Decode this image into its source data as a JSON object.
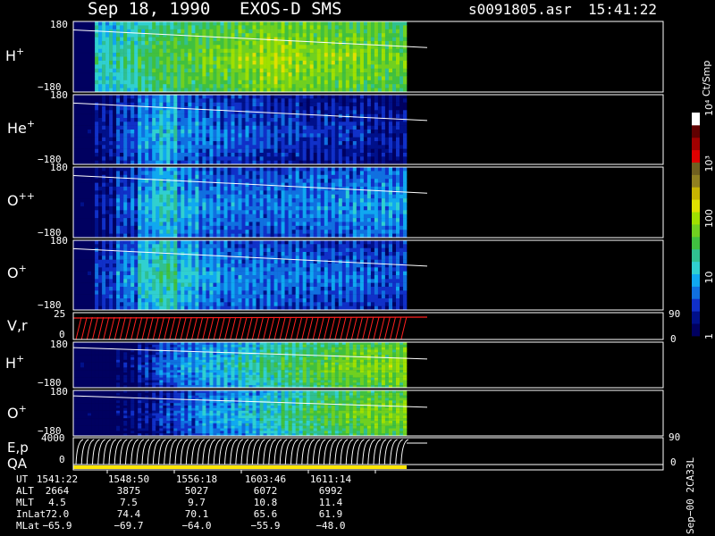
{
  "header": {
    "date": "Sep 18, 1990",
    "instrument": "EXOS-D SMS",
    "file": "s0091805.asr",
    "time": "15:41:22"
  },
  "colors": {
    "background": "#000000",
    "frame": "#ffffff",
    "noData": "#000000",
    "trace": "#ffffff",
    "velocity": "#ff2020",
    "qa": "#ffe600"
  },
  "chart_data": [
    {
      "type": "heatmap",
      "panels": [
        {
          "label": "H",
          "superscript": "+",
          "ymax": "180",
          "ymin": "−180",
          "intensity": [
            1,
            30,
            40,
            60,
            80,
            90,
            110,
            120,
            150,
            200,
            180,
            160,
            150,
            140,
            120,
            100
          ]
        },
        {
          "label": "He",
          "superscript": "+",
          "ymax": "180",
          "ymin": "−180",
          "intensity": [
            1,
            3,
            6,
            12,
            20,
            10,
            8,
            7,
            6,
            5,
            5,
            4,
            4,
            4,
            3,
            3
          ]
        },
        {
          "label": "O",
          "superscript": "++",
          "ymax": "180",
          "ymin": "−180",
          "intensity": [
            1,
            3,
            6,
            15,
            25,
            14,
            10,
            9,
            8,
            8,
            9,
            9,
            10,
            11,
            12,
            12
          ]
        },
        {
          "label": "O",
          "superscript": "+",
          "ymax": "180",
          "ymin": "−180",
          "intensity": [
            1,
            5,
            10,
            25,
            40,
            20,
            12,
            10,
            9,
            9,
            8,
            8,
            7,
            7,
            6,
            6
          ]
        }
      ],
      "colorbar": {
        "title": "Ct/Smp",
        "ticks": [
          "1",
          "10",
          "100",
          "10³",
          "10⁴"
        ],
        "tick_values": [
          1,
          10,
          100,
          1000,
          10000
        ],
        "colors": [
          "#000060",
          "#00108a",
          "#1030c8",
          "#1070e0",
          "#10a8f0",
          "#30d0d0",
          "#30c090",
          "#40c040",
          "#70d020",
          "#a0e000",
          "#e0e000",
          "#c8b400",
          "#908020",
          "#706020",
          "#e00000",
          "#a00000",
          "#600000",
          "#ffffff"
        ]
      }
    },
    {
      "type": "line",
      "label": "V,r",
      "ymax": "25",
      "ymin": "0",
      "right_ticks": [
        "90",
        "0"
      ]
    },
    {
      "type": "heatmap",
      "panels": [
        {
          "label": "H",
          "superscript": "+",
          "ymax": "180",
          "ymin": "−180",
          "intensity": [
            1,
            1,
            2,
            4,
            8,
            12,
            16,
            20,
            30,
            45,
            60,
            80,
            100,
            120,
            130,
            140
          ]
        },
        {
          "label": "O",
          "superscript": "+",
          "ymax": "180",
          "ymin": "−180",
          "intensity": [
            1,
            1,
            2,
            3,
            5,
            8,
            12,
            15,
            20,
            30,
            45,
            60,
            80,
            100,
            120,
            130
          ]
        }
      ]
    },
    {
      "type": "line",
      "label": "E,p",
      "ymax": "4000",
      "ymin": "0",
      "right_ticks": [
        "90",
        "0"
      ],
      "sublabel": "QA"
    }
  ],
  "ephemeris": {
    "rows": [
      "UT",
      "ALT",
      "MLT",
      "InLat",
      "MLat"
    ],
    "columns": [
      [
        "1541:22",
        "2664",
        "4.5",
        "72.0",
        "−65.9"
      ],
      [
        "1548:50",
        "3875",
        "7.5",
        "74.4",
        "−69.7"
      ],
      [
        "1556:18",
        "5027",
        "9.7",
        "70.1",
        "−64.0"
      ],
      [
        "1603:46",
        "6072",
        "10.8",
        "65.6",
        "−55.9"
      ],
      [
        "1611:14",
        "6992",
        "11.4",
        "61.9",
        "−48.0"
      ]
    ]
  },
  "footer": {
    "version": "Sep−00 2CA33L"
  }
}
